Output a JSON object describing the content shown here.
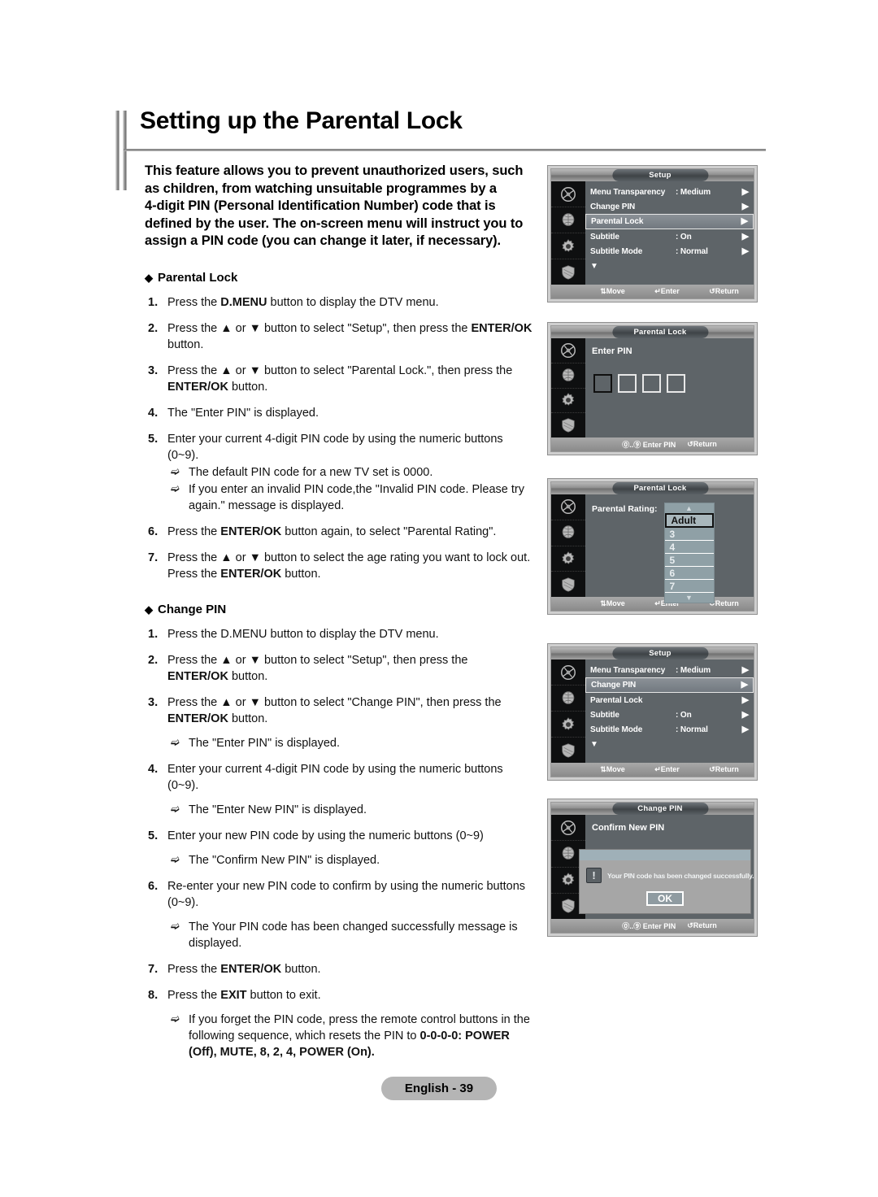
{
  "page": {
    "title": "Setting up the Parental Lock",
    "footer_label": "English - 39"
  },
  "intro": {
    "lines": [
      "This feature allows you to prevent unauthorized users, such",
      "as children, from watching unsuitable programmes by a",
      "4-digit PIN (Personal Identification Number) code that is",
      "defined by the user.  The on-screen menu will instruct you to",
      "assign a PIN code (you can change it later, if necessary)."
    ]
  },
  "sections": {
    "parental_lock": {
      "heading": "Parental Lock",
      "steps": [
        {
          "num": "1.",
          "text": "Press the D.MENU button to display the DTV menu."
        },
        {
          "num": "2.",
          "text": "Press the ▲ or ▼ button to select \"Setup\", then press the ENTER/OK button."
        },
        {
          "num": "3.",
          "text": "Press the ▲ or ▼ button to select \"Parental Lock.\", then press the ENTER/OK button."
        },
        {
          "num": "4.",
          "text": "The \"Enter PIN\" is displayed."
        },
        {
          "num": "5.",
          "text": "Enter your current 4-digit PIN code by using the numeric buttons (0~9)."
        }
      ],
      "notes_after_5": [
        "The default PIN code for a new TV set is 0000.",
        "If you enter an invalid PIN code,the \"Invalid PIN code. Please try again.\" message is displayed."
      ],
      "steps_tail": [
        {
          "num": "6.",
          "text": "Press the ENTER/OK button again, to select \"Parental Rating\"."
        },
        {
          "num": "7.",
          "text": "Press the ▲ or ▼ button to select the age rating you want to lock out. Press the ENTER/OK button."
        }
      ]
    },
    "change_pin": {
      "heading": "Change PIN",
      "items": [
        {
          "kind": "step",
          "num": "1.",
          "text": "Press the D.MENU button to display the DTV menu."
        },
        {
          "kind": "step",
          "num": "2.",
          "text": "Press the ▲ or ▼ button to select \"Setup\", then press the ENTER/OK button."
        },
        {
          "kind": "step",
          "num": "3.",
          "text": "Press the ▲ or ▼ button to select \"Change PIN\", then press the ENTER/OK button."
        },
        {
          "kind": "note",
          "text": "The \"Enter PIN\" is displayed."
        },
        {
          "kind": "step",
          "num": "4.",
          "text": "Enter your current 4-digit PIN code by using the numeric buttons (0~9)."
        },
        {
          "kind": "note",
          "text": "The \"Enter New PIN\" is displayed."
        },
        {
          "kind": "step",
          "num": "5.",
          "text": "Enter your new PIN code by using the numeric buttons (0~9)"
        },
        {
          "kind": "note",
          "text": "The \"Confirm New PIN\" is displayed."
        },
        {
          "kind": "step",
          "num": "6.",
          "text": "Re-enter your new PIN code to confirm by using the numeric buttons (0~9)."
        },
        {
          "kind": "note",
          "text": "The Your PIN code has been changed successfully message is displayed."
        },
        {
          "kind": "step",
          "num": "7.",
          "text": "Press the ENTER/OK button."
        },
        {
          "kind": "step",
          "num": "8.",
          "text": "Press the EXIT button to exit."
        },
        {
          "kind": "note",
          "text": "If you forget the PIN code, press the remote control buttons in the following sequence, which resets the PIN to 0-0-0-0: POWER (Off), MUTE, 8, 2, 4, POWER (On)."
        }
      ]
    }
  },
  "screenshots": {
    "setup_parental": {
      "title": "Setup",
      "rows": [
        {
          "label": "Menu Transparency",
          "value": ": Medium",
          "selected": false
        },
        {
          "label": "Change PIN",
          "value": "",
          "selected": false
        },
        {
          "label": "Parental Lock",
          "value": "",
          "selected": true
        },
        {
          "label": "Subtitle",
          "value": ": On",
          "selected": false
        },
        {
          "label": "Subtitle Mode",
          "value": ": Normal",
          "selected": false
        }
      ],
      "more_indicator": "▼",
      "footer": {
        "move": "Move",
        "enter": "Enter",
        "return": "Return"
      }
    },
    "enter_pin": {
      "title": "Parental Lock",
      "prompt": "Enter PIN",
      "boxes": 4,
      "footer": {
        "keys": "⓪..⑨",
        "enter_pin": "Enter PIN",
        "return": "Return"
      }
    },
    "parental_rating": {
      "title": "Parental Lock",
      "prompt": "Parental Rating:",
      "options": [
        "Adult",
        "3",
        "4",
        "5",
        "6",
        "7"
      ],
      "selected": "Adult",
      "up_arrow": "▲",
      "down_arrow": "▼",
      "footer": {
        "move": "Move",
        "enter": "Enter",
        "return": "Return"
      }
    },
    "setup_changepin": {
      "title": "Setup",
      "rows": [
        {
          "label": "Menu Transparency",
          "value": ": Medium",
          "selected": false
        },
        {
          "label": "Change PIN",
          "value": "",
          "selected": true
        },
        {
          "label": "Parental Lock",
          "value": "",
          "selected": false
        },
        {
          "label": "Subtitle",
          "value": ": On",
          "selected": false
        },
        {
          "label": "Subtitle Mode",
          "value": ": Normal",
          "selected": false
        }
      ],
      "more_indicator": "▼",
      "footer": {
        "move": "Move",
        "enter": "Enter",
        "return": "Return"
      }
    },
    "change_pin_confirm": {
      "title": "Change PIN",
      "prompt": "Confirm New  PIN",
      "dialog_message": "Your PIN code has been changed successfully.",
      "dialog_icon": "!",
      "ok_label": "OK",
      "footer": {
        "keys": "⓪..⑨",
        "enter_pin": "Enter PIN",
        "return": "Return"
      }
    }
  }
}
